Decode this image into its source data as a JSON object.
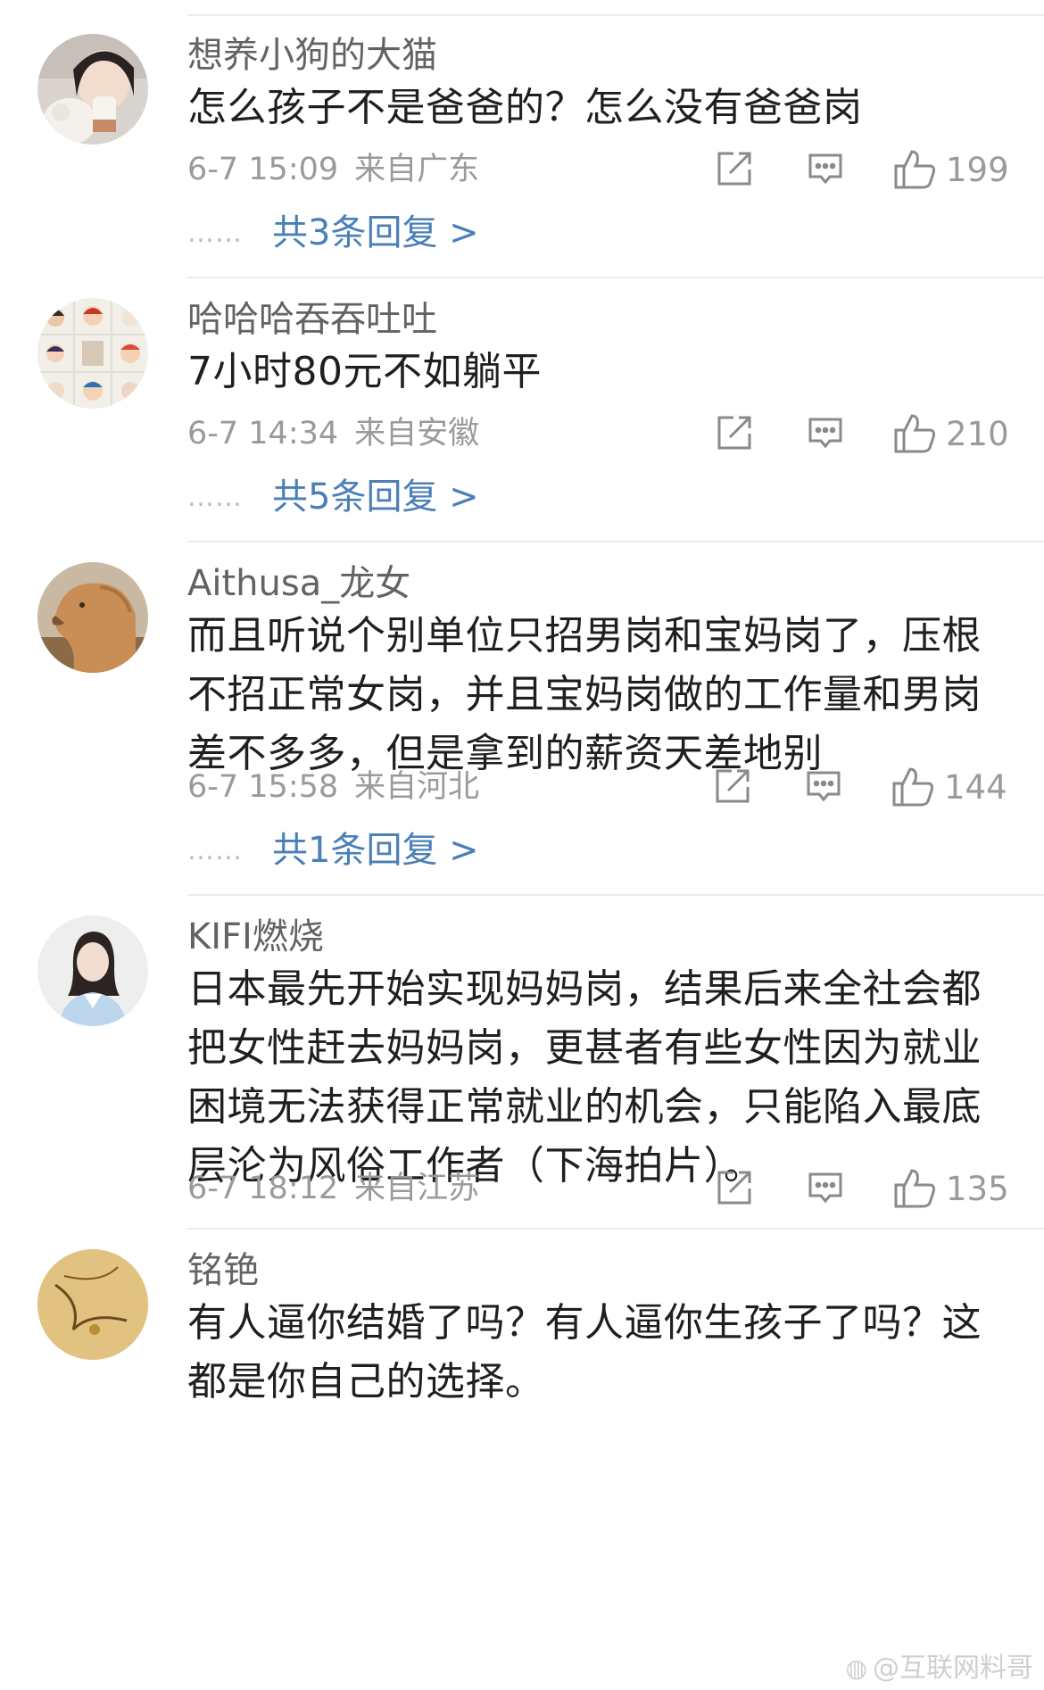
{
  "comments": [
    {
      "username": "想养小狗的大猫",
      "text": "怎么孩子不是爸爸的？怎么没有爸爸岗",
      "time": "6-7 15:09",
      "location": "来自广东",
      "likes": "199",
      "replies_dots": "……",
      "replies_label": "共3条回复 >"
    },
    {
      "username": "哈哈哈吞吞吐吐",
      "text": "7小时80元不如躺平",
      "time": "6-7 14:34",
      "location": "来自安徽",
      "likes": "210",
      "replies_dots": "……",
      "replies_label": "共5条回复 >"
    },
    {
      "username": "Aithusa_龙女",
      "text": "而且听说个别单位只招男岗和宝妈岗了，压根不招正常女岗，并且宝妈岗做的工作量和男岗差不多多，但是拿到的薪资天差地别",
      "time": "6-7 15:58",
      "location": "来自河北",
      "likes": "144",
      "replies_dots": "……",
      "replies_label": "共1条回复 >"
    },
    {
      "username": "KIFI燃烧",
      "text": "日本最先开始实现妈妈岗，结果后来全社会都把女性赶去妈妈岗，更甚者有些女性因为就业困境无法获得正常就业的机会，只能陷入最底层沦为风俗工作者（下海拍片）。",
      "time": "6-7 18:12",
      "location": "来自江苏",
      "likes": "135"
    },
    {
      "username": "铭铯",
      "text": "有人逼你结婚了吗？有人逼你生孩子了吗？这都是你自己的选择。"
    }
  ],
  "watermark": {
    "icon": "weibo-logo-icon",
    "text": "@互联网料哥"
  },
  "icons": {
    "share": "share-icon",
    "reply": "comment-icon",
    "like": "thumbs-up-icon"
  },
  "colors": {
    "link": "#4a7fb8",
    "meta": "#9a9a9a",
    "username": "#636363",
    "divider": "#ececec"
  }
}
